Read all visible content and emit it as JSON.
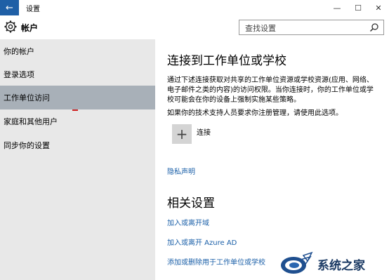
{
  "window": {
    "title": "设置",
    "back_icon": "back-arrow-icon",
    "minimize_glyph": "—",
    "maximize_glyph": "☐",
    "close_glyph": "✕"
  },
  "header": {
    "title": "帐户",
    "icon": "gear-icon",
    "search_placeholder": "查找设置"
  },
  "sidebar": {
    "items": [
      {
        "label": "你的帐户"
      },
      {
        "label": "登录选项"
      },
      {
        "label": "工作单位访问",
        "active": true
      },
      {
        "label": "家庭和其他用户"
      },
      {
        "label": "同步你的设置"
      }
    ]
  },
  "main": {
    "title": "连接到工作单位或学校",
    "description": "通过下述连接获取对共享的工作单位资源或学校资源(应用、网络、电子邮件之类的内容)的访问权限。当你连接时，你的工作单位或学校可能会在你的设备上强制实施某些策略。",
    "description2": "如果你的技术支持人员要求你注册管理，请使用此选项。",
    "connect_label": "连接",
    "privacy_link": "隐私声明",
    "related_title": "相关设置",
    "links": [
      "加入或离开域",
      "加入或离开 Azure AD",
      "添加或删除用于工作单位或学校"
    ]
  },
  "watermark": {
    "text": "系统之家"
  },
  "colors": {
    "accent": "#1f5fa6",
    "sidebar_bg": "#e8e8e8",
    "active_bg": "#a8b0b8",
    "link": "#1a5fa8"
  }
}
